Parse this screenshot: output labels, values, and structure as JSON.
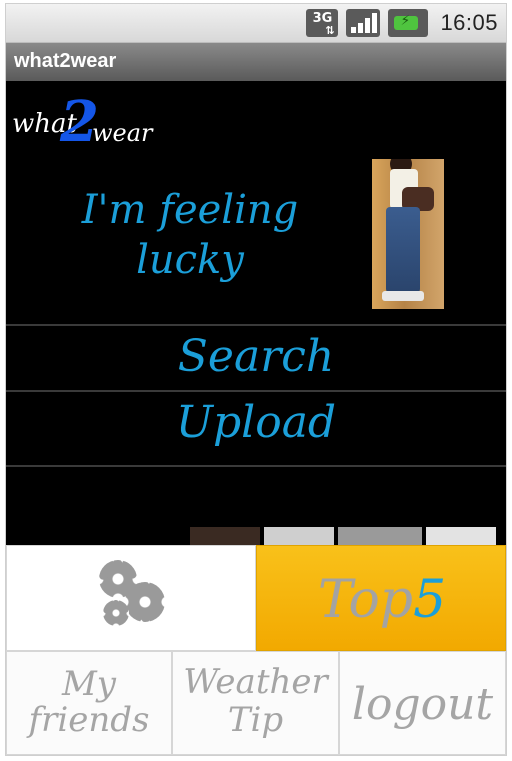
{
  "status_bar": {
    "network": "3G",
    "time": "16:05"
  },
  "app": {
    "title": "what2wear"
  },
  "logo": {
    "part1": "what",
    "part2": "2",
    "part3": "wear"
  },
  "main_menu": {
    "lucky_line1": "I'm  feeling",
    "lucky_line2": "lucky",
    "search": "Search",
    "upload": "Upload"
  },
  "tiles": {
    "top5_part1": "Top",
    "top5_part2": "5",
    "friends_line1": "My",
    "friends_line2": "friends",
    "weather_line1": "Weather",
    "weather_line2": "Tip",
    "logout": "logout"
  },
  "colors": {
    "accent_blue": "#1b9fd9",
    "top5_tile": "#f9b80e",
    "background": "#000000"
  },
  "icons": [
    "3g-icon",
    "signal-bars-icon",
    "battery-charging-icon",
    "settings-gears-icon"
  ]
}
